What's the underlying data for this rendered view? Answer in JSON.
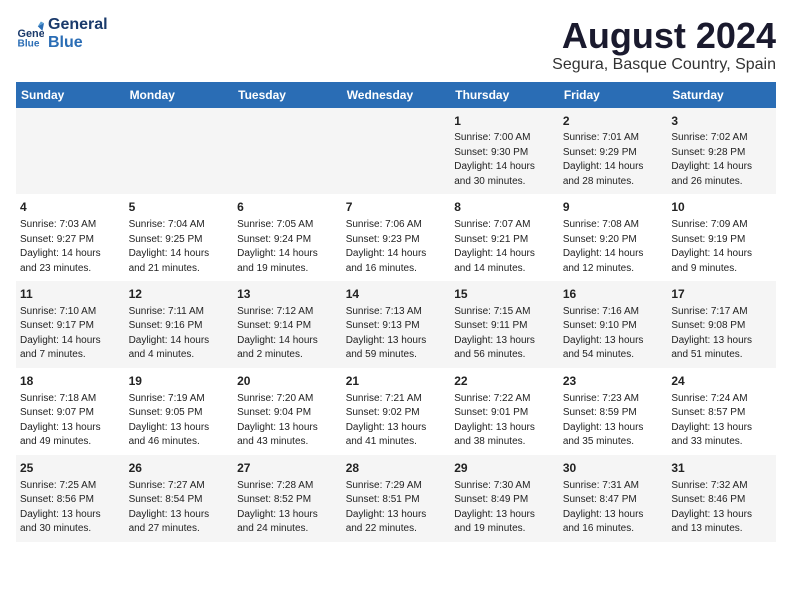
{
  "logo": {
    "line1": "General",
    "line2": "Blue"
  },
  "title": "August 2024",
  "subtitle": "Segura, Basque Country, Spain",
  "weekdays": [
    "Sunday",
    "Monday",
    "Tuesday",
    "Wednesday",
    "Thursday",
    "Friday",
    "Saturday"
  ],
  "weeks": [
    [
      {
        "day": "",
        "info": ""
      },
      {
        "day": "",
        "info": ""
      },
      {
        "day": "",
        "info": ""
      },
      {
        "day": "",
        "info": ""
      },
      {
        "day": "1",
        "info": "Sunrise: 7:00 AM\nSunset: 9:30 PM\nDaylight: 14 hours\nand 30 minutes."
      },
      {
        "day": "2",
        "info": "Sunrise: 7:01 AM\nSunset: 9:29 PM\nDaylight: 14 hours\nand 28 minutes."
      },
      {
        "day": "3",
        "info": "Sunrise: 7:02 AM\nSunset: 9:28 PM\nDaylight: 14 hours\nand 26 minutes."
      }
    ],
    [
      {
        "day": "4",
        "info": "Sunrise: 7:03 AM\nSunset: 9:27 PM\nDaylight: 14 hours\nand 23 minutes."
      },
      {
        "day": "5",
        "info": "Sunrise: 7:04 AM\nSunset: 9:25 PM\nDaylight: 14 hours\nand 21 minutes."
      },
      {
        "day": "6",
        "info": "Sunrise: 7:05 AM\nSunset: 9:24 PM\nDaylight: 14 hours\nand 19 minutes."
      },
      {
        "day": "7",
        "info": "Sunrise: 7:06 AM\nSunset: 9:23 PM\nDaylight: 14 hours\nand 16 minutes."
      },
      {
        "day": "8",
        "info": "Sunrise: 7:07 AM\nSunset: 9:21 PM\nDaylight: 14 hours\nand 14 minutes."
      },
      {
        "day": "9",
        "info": "Sunrise: 7:08 AM\nSunset: 9:20 PM\nDaylight: 14 hours\nand 12 minutes."
      },
      {
        "day": "10",
        "info": "Sunrise: 7:09 AM\nSunset: 9:19 PM\nDaylight: 14 hours\nand 9 minutes."
      }
    ],
    [
      {
        "day": "11",
        "info": "Sunrise: 7:10 AM\nSunset: 9:17 PM\nDaylight: 14 hours\nand 7 minutes."
      },
      {
        "day": "12",
        "info": "Sunrise: 7:11 AM\nSunset: 9:16 PM\nDaylight: 14 hours\nand 4 minutes."
      },
      {
        "day": "13",
        "info": "Sunrise: 7:12 AM\nSunset: 9:14 PM\nDaylight: 14 hours\nand 2 minutes."
      },
      {
        "day": "14",
        "info": "Sunrise: 7:13 AM\nSunset: 9:13 PM\nDaylight: 13 hours\nand 59 minutes."
      },
      {
        "day": "15",
        "info": "Sunrise: 7:15 AM\nSunset: 9:11 PM\nDaylight: 13 hours\nand 56 minutes."
      },
      {
        "day": "16",
        "info": "Sunrise: 7:16 AM\nSunset: 9:10 PM\nDaylight: 13 hours\nand 54 minutes."
      },
      {
        "day": "17",
        "info": "Sunrise: 7:17 AM\nSunset: 9:08 PM\nDaylight: 13 hours\nand 51 minutes."
      }
    ],
    [
      {
        "day": "18",
        "info": "Sunrise: 7:18 AM\nSunset: 9:07 PM\nDaylight: 13 hours\nand 49 minutes."
      },
      {
        "day": "19",
        "info": "Sunrise: 7:19 AM\nSunset: 9:05 PM\nDaylight: 13 hours\nand 46 minutes."
      },
      {
        "day": "20",
        "info": "Sunrise: 7:20 AM\nSunset: 9:04 PM\nDaylight: 13 hours\nand 43 minutes."
      },
      {
        "day": "21",
        "info": "Sunrise: 7:21 AM\nSunset: 9:02 PM\nDaylight: 13 hours\nand 41 minutes."
      },
      {
        "day": "22",
        "info": "Sunrise: 7:22 AM\nSunset: 9:01 PM\nDaylight: 13 hours\nand 38 minutes."
      },
      {
        "day": "23",
        "info": "Sunrise: 7:23 AM\nSunset: 8:59 PM\nDaylight: 13 hours\nand 35 minutes."
      },
      {
        "day": "24",
        "info": "Sunrise: 7:24 AM\nSunset: 8:57 PM\nDaylight: 13 hours\nand 33 minutes."
      }
    ],
    [
      {
        "day": "25",
        "info": "Sunrise: 7:25 AM\nSunset: 8:56 PM\nDaylight: 13 hours\nand 30 minutes."
      },
      {
        "day": "26",
        "info": "Sunrise: 7:27 AM\nSunset: 8:54 PM\nDaylight: 13 hours\nand 27 minutes."
      },
      {
        "day": "27",
        "info": "Sunrise: 7:28 AM\nSunset: 8:52 PM\nDaylight: 13 hours\nand 24 minutes."
      },
      {
        "day": "28",
        "info": "Sunrise: 7:29 AM\nSunset: 8:51 PM\nDaylight: 13 hours\nand 22 minutes."
      },
      {
        "day": "29",
        "info": "Sunrise: 7:30 AM\nSunset: 8:49 PM\nDaylight: 13 hours\nand 19 minutes."
      },
      {
        "day": "30",
        "info": "Sunrise: 7:31 AM\nSunset: 8:47 PM\nDaylight: 13 hours\nand 16 minutes."
      },
      {
        "day": "31",
        "info": "Sunrise: 7:32 AM\nSunset: 8:46 PM\nDaylight: 13 hours\nand 13 minutes."
      }
    ]
  ]
}
